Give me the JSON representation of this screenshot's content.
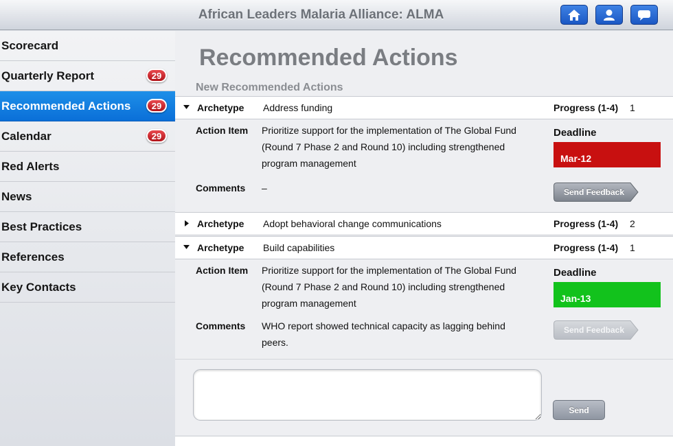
{
  "header": {
    "title": "African Leaders Malaria Alliance: ALMA"
  },
  "topbar_buttons": [
    {
      "icon": "home-icon"
    },
    {
      "icon": "user-icon"
    },
    {
      "icon": "chat-bubble-icon"
    }
  ],
  "colors": {
    "accent": "#1173e0",
    "badge": "#c8161c",
    "deadline_red": "#c81010",
    "deadline_green": "#12c21c"
  },
  "sidebar": {
    "items": [
      {
        "label": "Scorecard",
        "badge": null,
        "active": false
      },
      {
        "label": "Quarterly Report",
        "badge": "29",
        "active": false
      },
      {
        "label": "Recommended Actions",
        "badge": "29",
        "active": true
      },
      {
        "label": "Calendar",
        "badge": "29",
        "active": false
      },
      {
        "label": "Red Alerts",
        "badge": null,
        "active": false
      },
      {
        "label": "News",
        "badge": null,
        "active": false
      },
      {
        "label": "Best Practices",
        "badge": null,
        "active": false
      },
      {
        "label": "References",
        "badge": null,
        "active": false
      },
      {
        "label": "Key Contacts",
        "badge": null,
        "active": false
      }
    ]
  },
  "main": {
    "title": "Recommended Actions",
    "section_title": "New Recommended Actions",
    "archetype_label": "Archetype",
    "progress_label": "Progress (1-4)",
    "action_item_label": "Action Item",
    "comments_label": "Comments",
    "deadline_label": "Deadline",
    "feedback_label": "Send Feedback",
    "send_label": "Send",
    "comment_input_value": "",
    "rows": [
      {
        "archetype": "Address funding",
        "progress": "1",
        "expanded": true,
        "action_item": "Prioritize support for the implementation of The Global Fund (Round 7 Phase 2 and Round 10) including strengthened program management",
        "comments": "–",
        "deadline": "Mar-12",
        "deadline_color": "#c81010",
        "feedback_enabled": true
      },
      {
        "archetype": "Adopt behavioral change communications",
        "progress": "2",
        "expanded": false
      },
      {
        "archetype": "Build capabilities",
        "progress": "1",
        "expanded": true,
        "action_item": "Prioritize support for the implementation of The Global Fund (Round 7 Phase 2 and Round 10) including strengthened program management",
        "comments": "WHO report showed technical capacity as lagging behind peers.",
        "deadline": "Jan-13",
        "deadline_color": "#12c21c",
        "feedback_enabled": false
      }
    ]
  }
}
